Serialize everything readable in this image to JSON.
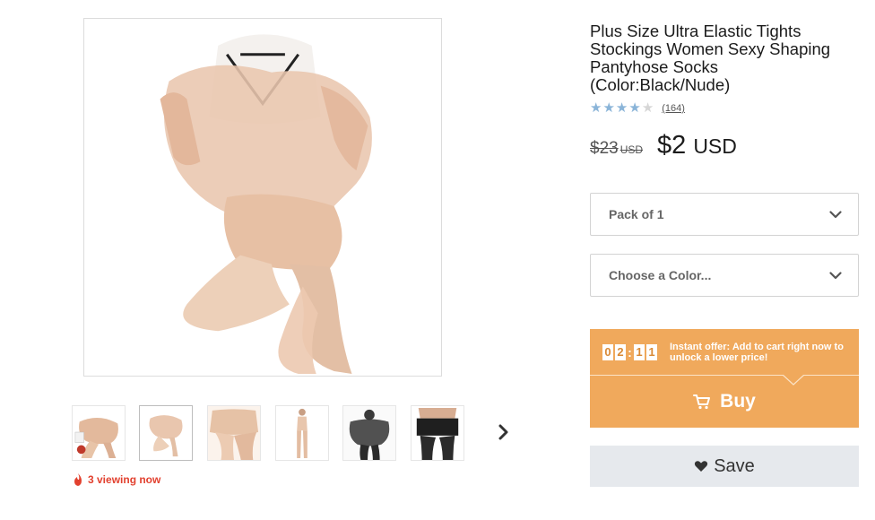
{
  "product": {
    "title": "Plus Size Ultra Elastic Tights Stockings Women Sexy Shaping Pantyhose Socks (Color:Black/Nude)",
    "rating_stars": 4,
    "rating_max": 5,
    "review_count": "(164)",
    "old_price": "$23",
    "old_currency": "USD",
    "price": "$2",
    "currency": "USD"
  },
  "gallery": {
    "viewing_text": "3 viewing now",
    "thumbnail_count": 6
  },
  "options": {
    "pack_value": "Pack of 1",
    "color_placeholder": "Choose a Color..."
  },
  "offer": {
    "timer_digits": [
      "0",
      "2",
      "1",
      "1"
    ],
    "text": "Instant offer: Add to cart right now to unlock a lower price!"
  },
  "actions": {
    "buy_label": "Buy",
    "save_label": "Save"
  },
  "colors": {
    "accent_orange": "#f0a95c",
    "star_blue": "#8ab4d8",
    "viewing_red": "#e2412f",
    "save_bg": "#e6e9ed"
  }
}
